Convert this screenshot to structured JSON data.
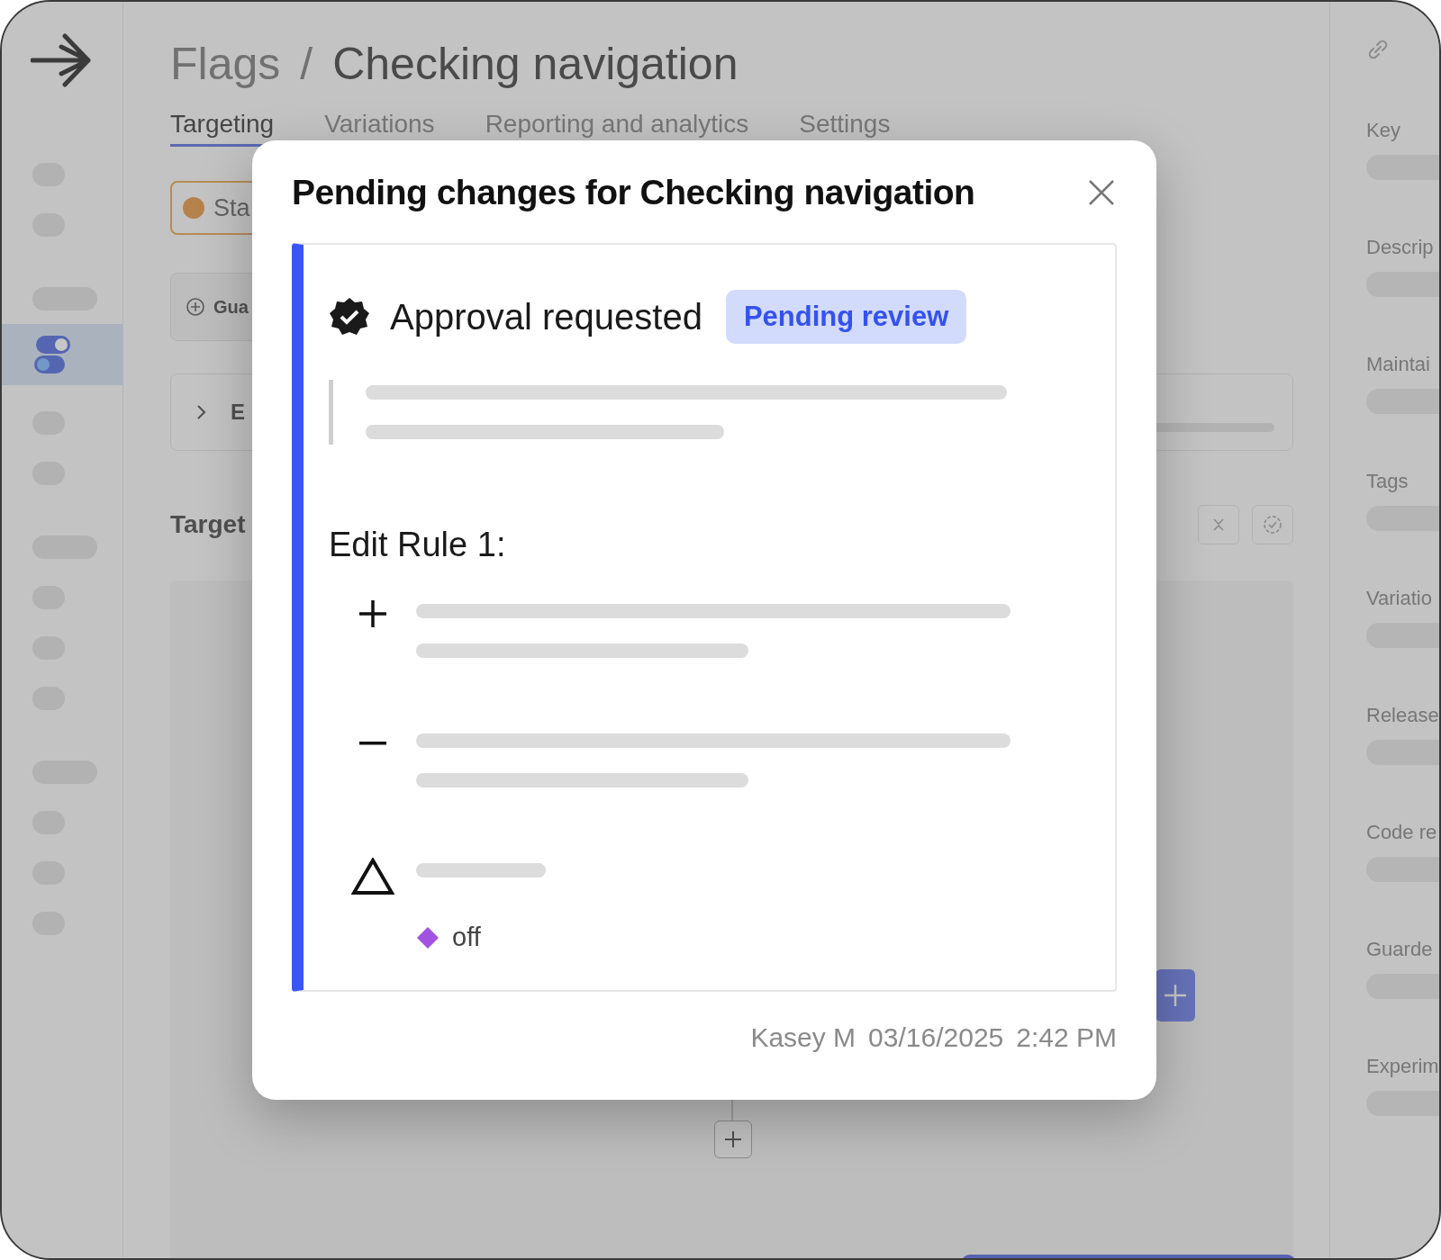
{
  "app": {
    "breadcrumb": {
      "parent": "Flags",
      "separator": "/",
      "current": "Checking navigation"
    },
    "tabs": [
      {
        "label": "Targeting",
        "selected": true
      },
      {
        "label": "Variations",
        "selected": false
      },
      {
        "label": "Reporting and analytics",
        "selected": false
      },
      {
        "label": "Settings",
        "selected": false
      }
    ],
    "sidebar": {
      "items": [
        {
          "kind": "short",
          "selected": false
        },
        {
          "kind": "short",
          "selected": false
        },
        {
          "kind": "long",
          "selected": false
        },
        {
          "kind": "toggle",
          "selected": true
        },
        {
          "kind": "short",
          "selected": false
        },
        {
          "kind": "short",
          "selected": false
        },
        {
          "kind": "long",
          "selected": false
        },
        {
          "kind": "short",
          "selected": false
        },
        {
          "kind": "short",
          "selected": false
        },
        {
          "kind": "short",
          "selected": false
        },
        {
          "kind": "long",
          "selected": false
        },
        {
          "kind": "short",
          "selected": false
        },
        {
          "kind": "short",
          "selected": false
        },
        {
          "kind": "short",
          "selected": false
        }
      ]
    },
    "status_pill": {
      "label": "Sta"
    },
    "guard_button": {
      "label": "Gua"
    },
    "expander": {
      "label": "E"
    },
    "section_title": "Target",
    "details": [
      "Key",
      "Descrip",
      "Maintai",
      "Tags",
      "Variatio",
      "Release",
      "Code re",
      "Guarde",
      "Experim"
    ]
  },
  "modal": {
    "title": "Pending changes for Checking navigation",
    "status": {
      "title": "Approval requested",
      "badge": "Pending review"
    },
    "rule_title": "Edit Rule 1:",
    "changes": [
      {
        "kind": "added"
      },
      {
        "kind": "removed"
      },
      {
        "kind": "changed",
        "value": {
          "label": "off",
          "color": "#a152e0"
        }
      }
    ],
    "footer": {
      "author": "Kasey M",
      "date": "03/16/2025",
      "time": "2:42 PM"
    }
  }
}
